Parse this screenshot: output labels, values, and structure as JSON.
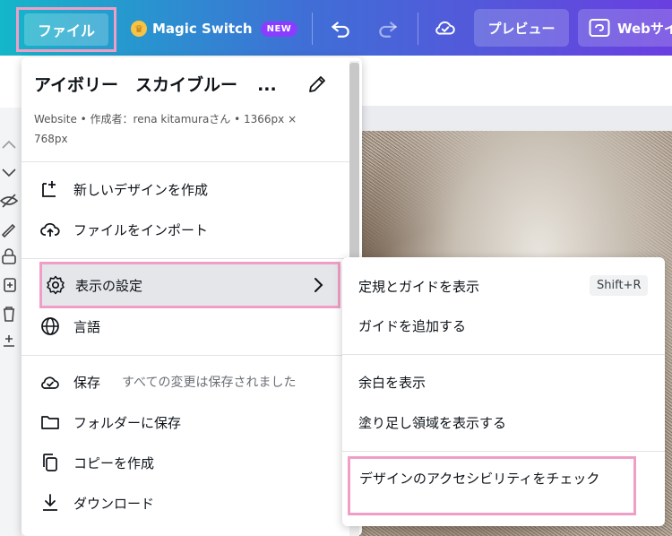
{
  "topbar": {
    "file_label": "ファイル",
    "magic_label": "Magic Switch",
    "new_badge": "NEW",
    "preview_label": "プレビュー",
    "web_label": "Webサイ"
  },
  "file_menu": {
    "title": "アイボリー　スカイブルー",
    "title_more": "...",
    "subtitle": "Website • 作成者：rena kitamuraさん • 1366px × 768px",
    "items": [
      {
        "label": "新しいデザインを作成"
      },
      {
        "label": "ファイルをインポート"
      },
      {
        "label": "表示の設定"
      },
      {
        "label": "言語"
      },
      {
        "label": "保存",
        "aux": "すべての変更は保存されました"
      },
      {
        "label": "フォルダーに保存"
      },
      {
        "label": "コピーを作成"
      },
      {
        "label": "ダウンロード"
      }
    ]
  },
  "view_submenu": {
    "items": [
      {
        "label": "定規とガイドを表示",
        "shortcut": "Shift+R"
      },
      {
        "label": "ガイドを追加する"
      },
      {
        "label": "余白を表示"
      },
      {
        "label": "塗り足し領域を表示する"
      },
      {
        "label": "デザインのアクセシビリティをチェック"
      }
    ]
  },
  "colors": {
    "highlight_border": "#ef9fc6",
    "topbar_start": "#14b6c9",
    "topbar_end": "#6a3fe0",
    "new_badge": "#8b3dff"
  }
}
